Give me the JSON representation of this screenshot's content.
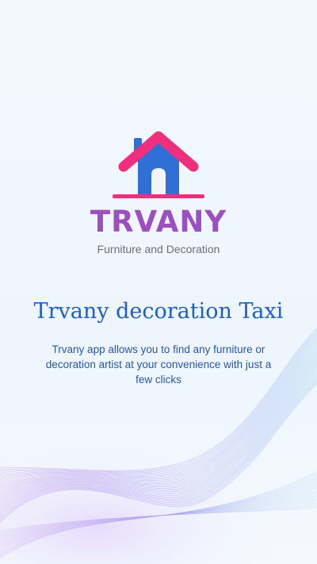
{
  "brand": {
    "name": "TRVANY",
    "tagline": "Furniture and Decoration"
  },
  "intro": {
    "headline": "Trvany decoration Taxi",
    "description": "Trvany app allows you to find any furniture or decoration artist at your convenience with just a few clicks"
  },
  "colors": {
    "roof": "#ef2f7e",
    "house": "#2f6fd6",
    "brand_text": "#9b4fc0",
    "headline": "#1d5fc4",
    "background": "#f1f6fd",
    "wave_blue": "#7fb2e6",
    "wave_purple": "#b084e6"
  },
  "icons": {
    "logo": "house-icon",
    "background": "wave-lines-decoration"
  }
}
